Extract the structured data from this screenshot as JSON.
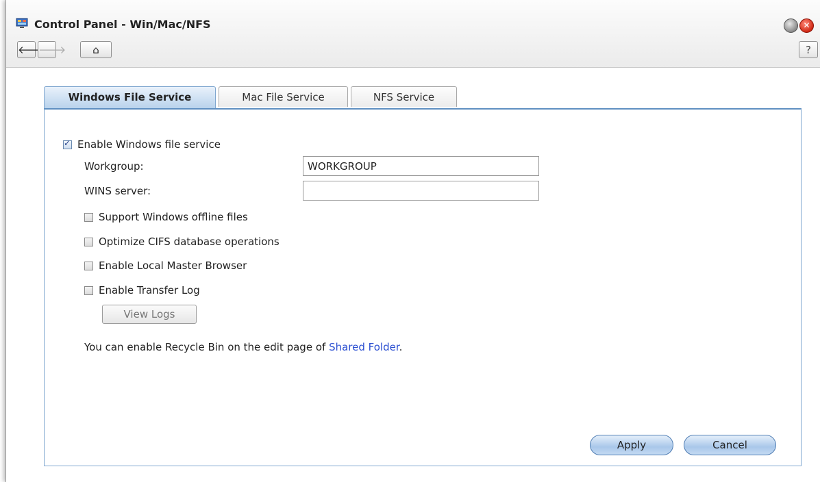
{
  "window": {
    "title": "Control Panel - Win/Mac/NFS",
    "help_label": "?",
    "close_glyph": "✕"
  },
  "nav": {
    "back_glyph": "🡐",
    "forward_glyph": "🡒",
    "home_glyph": "⌂"
  },
  "tabs": [
    {
      "label": "Windows File Service",
      "active": true
    },
    {
      "label": "Mac File Service",
      "active": false
    },
    {
      "label": "NFS Service",
      "active": false
    }
  ],
  "form": {
    "enable_windows": {
      "label": "Enable Windows file service",
      "checked": true
    },
    "workgroup": {
      "label": "Workgroup:",
      "value": "WORKGROUP"
    },
    "wins": {
      "label": "WINS server:",
      "value": ""
    },
    "options": [
      {
        "label": "Support Windows offline files",
        "checked": false
      },
      {
        "label": "Optimize CIFS database operations",
        "checked": false
      },
      {
        "label": "Enable Local Master Browser",
        "checked": false
      },
      {
        "label": "Enable Transfer Log",
        "checked": false
      }
    ],
    "view_logs_label": "View Logs",
    "info_text": "You can enable Recycle Bin on the edit page of ",
    "info_link": "Shared Folder",
    "info_suffix": "."
  },
  "buttons": {
    "apply": "Apply",
    "cancel": "Cancel"
  },
  "icons": [
    "control-panel-icon",
    "back-arrow-icon",
    "forward-arrow-icon",
    "home-icon",
    "help-icon",
    "minimize-icon",
    "close-icon"
  ]
}
